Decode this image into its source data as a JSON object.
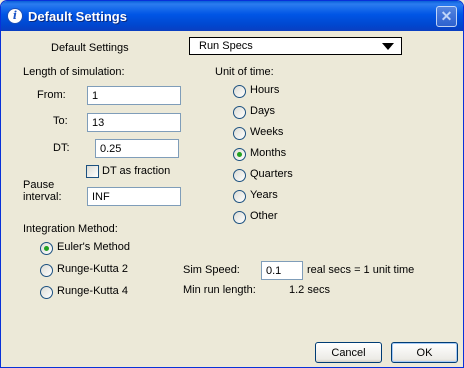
{
  "window": {
    "title": "Default Settings",
    "close_glyph": "✕"
  },
  "header": {
    "label": "Default Settings",
    "dropdown_value": "Run Specs"
  },
  "simulation": {
    "section_label": "Length of simulation:",
    "from_label": "From:",
    "from_value": "1",
    "to_label": "To:",
    "to_value": "13",
    "dt_label": "DT:",
    "dt_value": "0.25",
    "dt_fraction_label": "DT as fraction",
    "dt_fraction_checked": false,
    "pause_label_1": "Pause",
    "pause_label_2": "interval:",
    "pause_value": "INF"
  },
  "time_unit": {
    "section_label": "Unit of time:",
    "options": [
      "Hours",
      "Days",
      "Weeks",
      "Months",
      "Quarters",
      "Years",
      "Other"
    ],
    "selected": "Months"
  },
  "integration": {
    "section_label": "Integration Method:",
    "options": [
      "Euler's Method",
      "Runge-Kutta 2",
      "Runge-Kutta 4"
    ],
    "selected": "Euler's Method"
  },
  "speed": {
    "label": "Sim Speed:",
    "value": "0.1",
    "suffix": "real secs = 1 unit time",
    "min_run_label": "Min run length:",
    "min_run_value": "1.2 secs"
  },
  "buttons": {
    "cancel": "Cancel",
    "ok": "OK"
  }
}
